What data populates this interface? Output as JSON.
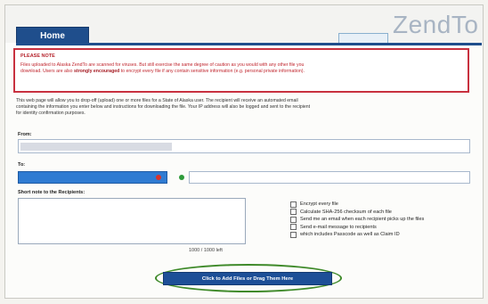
{
  "header": {
    "home_tab": "Home",
    "logo": "ZendTo"
  },
  "notice": {
    "title": "PLEASE NOTE",
    "line1": "Files uploaded to Alaska ZendTo are scanned for viruses. But still exercise the same degree of caution as you would with any other file you",
    "line2_pre": "download. Users are also ",
    "line2_strong": "strongly encouraged",
    "line2_post": " to encrypt every file if any contain sensitive information (e.g. personal private information)."
  },
  "intro": {
    "line1": "This web page will allow you to drop-off (upload) one or more files for a State of Alaska user. The recipient will receive an automated email",
    "line2": "containing the information you enter below and instructions for downloading the file. Your IP address will also be logged and sent to the recipient",
    "line3": "for identity confirmation purposes."
  },
  "form": {
    "from_label": "From:",
    "to_label": "To:",
    "note_label": "Short note to the Recipients:",
    "note_value": "",
    "char_counter": "1000 / 1000 left"
  },
  "options": [
    "Encrypt every file",
    "Calculate SHA-256 checksum of each file",
    "Send me an email when each recipient picks up the files",
    "Send e-mail message to recipients",
    "which includes Passcode as well as Claim ID"
  ],
  "upload_button": "Click to Add Files or Drag Them Here",
  "colors": {
    "brand_blue": "#1f4e8c",
    "notice_red": "#c8313f",
    "highlight_green": "#3f8a2a"
  }
}
